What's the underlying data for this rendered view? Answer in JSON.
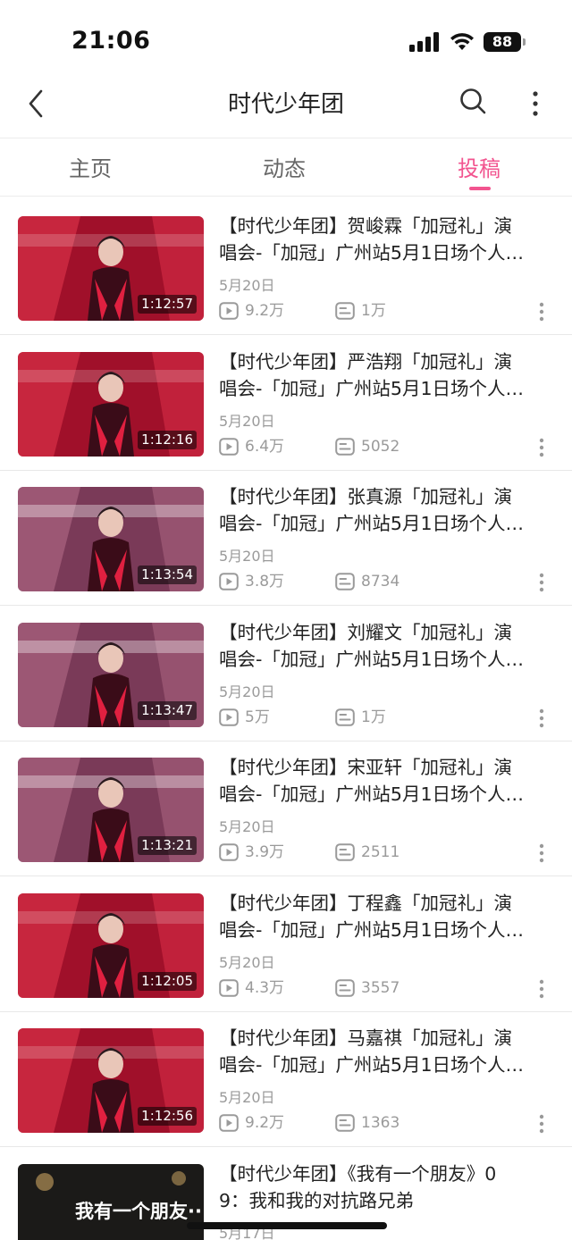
{
  "status_bar": {
    "time": "21:06",
    "battery": "88"
  },
  "nav": {
    "title": "时代少年团",
    "back_icon": "chevron-left-icon",
    "search_icon": "search-icon",
    "more_icon": "vertical-dots-icon"
  },
  "tabs": [
    {
      "label": "主页",
      "active": false
    },
    {
      "label": "动态",
      "active": false
    },
    {
      "label": "投稿",
      "active": true
    }
  ],
  "accent_color": "#f2548f",
  "videos": [
    {
      "title_line1": "【时代少年团】贺峻霖「加冠礼」演",
      "title_line2": "唱会-「加冠」广州站5月1日场个人…",
      "date": "5月20日",
      "plays": "9.2万",
      "danmaku": "1万",
      "duration": "1:12:57",
      "thumb": "concert-red"
    },
    {
      "title_line1": "【时代少年团】严浩翔「加冠礼」演",
      "title_line2": "唱会-「加冠」广州站5月1日场个人…",
      "date": "5月20日",
      "plays": "6.4万",
      "danmaku": "5052",
      "duration": "1:12:16",
      "thumb": "concert-red"
    },
    {
      "title_line1": "【时代少年团】张真源「加冠礼」演",
      "title_line2": "唱会-「加冠」广州站5月1日场个人…",
      "date": "5月20日",
      "plays": "3.8万",
      "danmaku": "8734",
      "duration": "1:13:54",
      "thumb": "concert-purple"
    },
    {
      "title_line1": "【时代少年团】刘耀文「加冠礼」演",
      "title_line2": "唱会-「加冠」广州站5月1日场个人…",
      "date": "5月20日",
      "plays": "5万",
      "danmaku": "1万",
      "duration": "1:13:47",
      "thumb": "concert-purple"
    },
    {
      "title_line1": "【时代少年团】宋亚轩「加冠礼」演",
      "title_line2": "唱会-「加冠」广州站5月1日场个人…",
      "date": "5月20日",
      "plays": "3.9万",
      "danmaku": "2511",
      "duration": "1:13:21",
      "thumb": "concert-purple"
    },
    {
      "title_line1": "【时代少年团】丁程鑫「加冠礼」演",
      "title_line2": "唱会-「加冠」广州站5月1日场个人…",
      "date": "5月20日",
      "plays": "4.3万",
      "danmaku": "3557",
      "duration": "1:12:05",
      "thumb": "concert-red"
    },
    {
      "title_line1": "【时代少年团】马嘉祺「加冠礼」演",
      "title_line2": "唱会-「加冠」广州站5月1日场个人…",
      "date": "5月20日",
      "plays": "9.2万",
      "danmaku": "1363",
      "duration": "1:12:56",
      "thumb": "concert-red"
    },
    {
      "title_line1": "【时代少年团】《我有一个朋友》0",
      "title_line2": "9：我和我的对抗路兄弟",
      "date": "5月17日",
      "plays": "",
      "danmaku": "",
      "duration": "",
      "thumb": "show-dark",
      "thumb_text": "我有一个朋友···"
    }
  ]
}
